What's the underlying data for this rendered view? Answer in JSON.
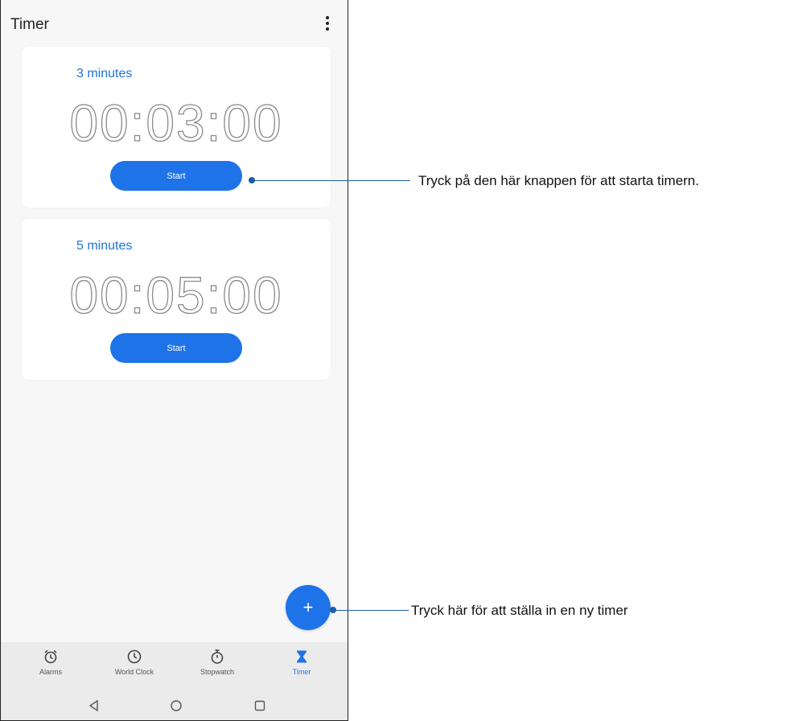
{
  "app_title": "Timer",
  "timers": [
    {
      "label": "3 minutes",
      "time": "00:03:00",
      "button": "Start"
    },
    {
      "label": "5 minutes",
      "time": "00:05:00",
      "button": "Start"
    }
  ],
  "fab": {
    "icon": "plus-icon",
    "symbol": "+"
  },
  "bottom_nav": [
    {
      "label": "Alarms",
      "icon": "alarm-clock-icon"
    },
    {
      "label": "World Clock",
      "icon": "clock-icon"
    },
    {
      "label": "Stopwatch",
      "icon": "stopwatch-icon"
    },
    {
      "label": "Timer",
      "icon": "hourglass-icon",
      "active": true
    }
  ],
  "system_nav": [
    "back-icon",
    "home-icon",
    "recents-icon"
  ],
  "callouts": {
    "start": "Tryck på den här knappen för att starta timern.",
    "fab": "Tryck här för att ställa in en ny timer"
  },
  "colors": {
    "accent": "#1e73e8",
    "label_blue": "#1e73d8",
    "callout_line": "#1a5fa8"
  }
}
